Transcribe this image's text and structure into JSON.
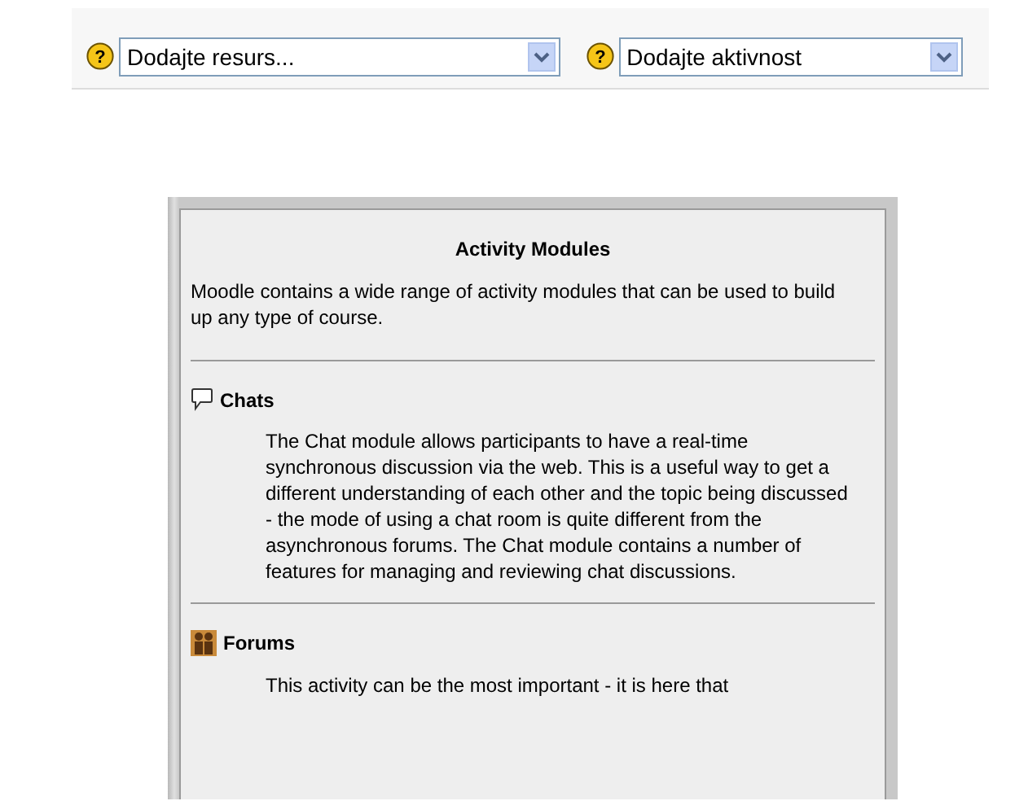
{
  "toolbar": {
    "selects": [
      {
        "help": "?",
        "value": "Dodajte resurs..."
      },
      {
        "help": "?",
        "value": "Dodajte aktivnost"
      }
    ]
  },
  "panel": {
    "title": "Activity Modules",
    "intro": "Moodle contains a wide range of activity modules that can be used to build up any type of course.",
    "modules": [
      {
        "kind": "chat",
        "name": "Chats",
        "description": "The Chat module allows participants to have a real-time synchronous discussion via the web. This is a useful way to get a different understanding of each other and the topic being discussed - the mode of using a chat room is quite different from the asynchronous forums. The Chat module contains a number of features for managing and reviewing chat discussions."
      },
      {
        "kind": "forum",
        "name": "Forums",
        "description": "This activity can be the most important - it is here that"
      }
    ]
  }
}
